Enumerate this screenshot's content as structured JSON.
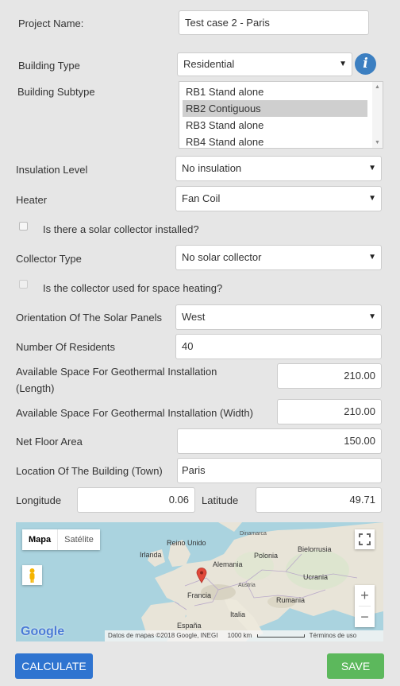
{
  "form": {
    "project_name": {
      "label": "Project Name:",
      "value": "Test case 2 - Paris"
    },
    "building_type": {
      "label": "Building Type",
      "value": "Residential"
    },
    "building_subtype": {
      "label": "Building Subtype",
      "options": [
        "RB1 Stand alone",
        "RB2 Contiguous",
        "RB3 Stand alone",
        "RB4 Stand alone"
      ],
      "selected_index": 1
    },
    "insulation_level": {
      "label": "Insulation Level",
      "value": "No insulation"
    },
    "heater": {
      "label": "Heater",
      "value": "Fan Coil"
    },
    "solar_collector_installed": {
      "label": "Is there a solar collector installed?",
      "checked": false
    },
    "collector_type": {
      "label": "Collector Type",
      "value": "No solar collector"
    },
    "collector_space_heating": {
      "label": "Is the collector used for space heating?",
      "checked": false
    },
    "orientation": {
      "label": "Orientation Of The Solar Panels",
      "value": "West"
    },
    "residents": {
      "label": "Number Of Residents",
      "value": "40"
    },
    "geo_length": {
      "label_line1": "Available Space For Geothermal Installation",
      "label_line2": "(Length)",
      "value": "210.00"
    },
    "geo_width": {
      "label": "Available Space For Geothermal Installation (Width)",
      "value": "210.00"
    },
    "floor_area": {
      "label": "Net Floor Area",
      "value": "150.00"
    },
    "location": {
      "label": "Location Of The Building (Town)",
      "value": "Paris"
    },
    "longitude": {
      "label": "Longitude",
      "value": "0.06"
    },
    "latitude": {
      "label": "Latitude",
      "value": "49.71"
    }
  },
  "map": {
    "type_buttons": [
      "Mapa",
      "Satélite"
    ],
    "labels": {
      "reino_unido": "Reino Unido",
      "irlanda": "Irlanda",
      "dinamarca": "Dinamarca",
      "polonia": "Polonia",
      "bielorrusia": "Bielorrusia",
      "alemania": "Alemania",
      "ucrania": "Ucrania",
      "austria": "Austria",
      "francia": "Francia",
      "rumania": "Rumania",
      "italia": "Italia",
      "espana": "España"
    },
    "logo": "Google",
    "attribution": "Datos de mapas ©2018 Google, INEGI",
    "scale": "1000 km",
    "terms": "Términos de uso",
    "zoom_in": "+",
    "zoom_out": "−",
    "colors": {
      "water": "#aad3df",
      "land": "#e8e4d8",
      "marker": "#e0483a"
    }
  },
  "actions": {
    "calculate": "CALCULATE",
    "save": "SAVE"
  },
  "colors": {
    "background": "#e6e6e6",
    "info": "#3c7fc1",
    "calculate": "#2f74d0",
    "save": "#5cb85c"
  },
  "icons": {
    "info": "i",
    "caret": "▼"
  }
}
